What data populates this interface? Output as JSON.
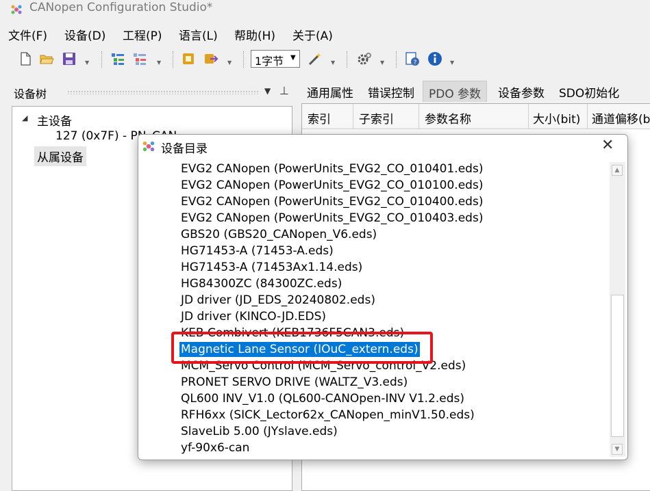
{
  "window": {
    "title": "CANopen Configuration Studio*",
    "app_icon": "app-logo-icon"
  },
  "menu": [
    "文件(F)",
    "设备(D)",
    "工程(P)",
    "语言(L)",
    "帮助(H)",
    "关于(A)"
  ],
  "toolbar": {
    "icons": [
      "new-file-icon",
      "open-folder-icon",
      "save-icon",
      "add-device-icon",
      "remove-device-icon",
      "import-icon",
      "export-icon",
      "magic-wand-icon",
      "settings-gear-icon",
      "help-document-icon",
      "info-icon"
    ],
    "byte_select": {
      "value": "1字节"
    }
  },
  "left_pane": {
    "title": "设备树",
    "tree": {
      "master_label": "主设备",
      "master_node": "127 (0x7F)  -  PN_CAN",
      "slave_label": "从属设备"
    }
  },
  "tabs": [
    "通用属性",
    "错误控制",
    "PDO 参数",
    "设备参数",
    "SDO初始化"
  ],
  "active_tab": "PDO 参数",
  "grid": {
    "columns": [
      "索引",
      "子索引",
      "参数名称",
      "大小(bit)",
      "通道偏移(bit)"
    ]
  },
  "dialog": {
    "title": "设备目录",
    "items": [
      "EVG2 CANopen (PowerUnits_EVG2_CO_010401.eds)",
      "EVG2 CANopen (PowerUnits_EVG2_CO_010100.eds)",
      "EVG2 CANopen (PowerUnits_EVG2_CO_010400.eds)",
      "EVG2 CANopen (PowerUnits_EVG2_CO_010403.eds)",
      "GBS20 (GBS20_CANopen_V6.eds)",
      "HG71453-A (71453-A.eds)",
      "HG71453-A (71453Ax1.14.eds)",
      "HG84300ZC (84300ZC.eds)",
      "JD driver (JD_EDS_20240802.eds)",
      "JD driver (KINCO-JD.EDS)",
      "KEB Combivert (KEB1736F5CAN3.eds)",
      "Magnetic Lane Sensor (IOuC_extern.eds)",
      "MCM_Servo Control (MCM_Servo_control_V2.eds)",
      "PRONET SERVO DRIVE (WALTZ_V3.eds)",
      "QL600 INV_V1.0 (QL600-CANOpen-INV V1.2.eds)",
      "RFH6xx (SICK_Lector62x_CANopen_minV1.50.eds)",
      "SlaveLib 5.00 (JYslave.eds)",
      "yf-90x6-can"
    ],
    "selected_index": 11
  },
  "colors": {
    "selection": "#0078d7",
    "annotation_box": "#e8141b",
    "active_tab_bg": "#dcdcdc"
  }
}
